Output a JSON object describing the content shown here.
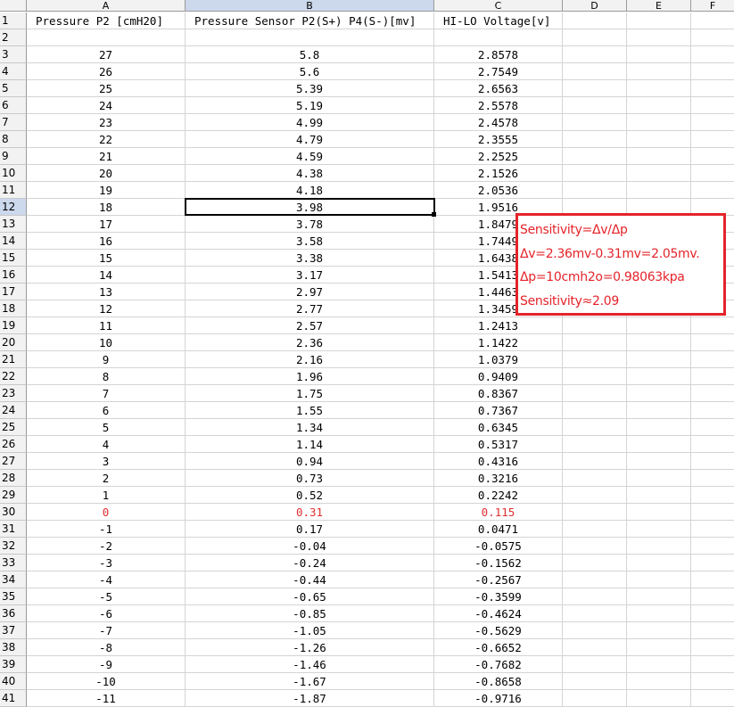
{
  "columns": [
    "A",
    "B",
    "C",
    "D",
    "E",
    "F"
  ],
  "selected_column": "B",
  "selected_row": "12",
  "rows": [
    {
      "n": "1",
      "a": "Pressure P2 [cmH20]",
      "b": "Pressure Sensor P2(S+) P4(S-)[mv]",
      "c": "HI-LO Voltage[v]"
    },
    {
      "n": "2",
      "a": "",
      "b": "",
      "c": ""
    },
    {
      "n": "3",
      "a": "27",
      "b": "5.8",
      "c": "2.8578"
    },
    {
      "n": "4",
      "a": "26",
      "b": "5.6",
      "c": "2.7549"
    },
    {
      "n": "5",
      "a": "25",
      "b": "5.39",
      "c": "2.6563"
    },
    {
      "n": "6",
      "a": "24",
      "b": "5.19",
      "c": "2.5578"
    },
    {
      "n": "7",
      "a": "23",
      "b": "4.99",
      "c": "2.4578"
    },
    {
      "n": "8",
      "a": "22",
      "b": "4.79",
      "c": "2.3555"
    },
    {
      "n": "9",
      "a": "21",
      "b": "4.59",
      "c": "2.2525"
    },
    {
      "n": "10",
      "a": "20",
      "b": "4.38",
      "c": "2.1526"
    },
    {
      "n": "11",
      "a": "19",
      "b": "4.18",
      "c": "2.0536"
    },
    {
      "n": "12",
      "a": "18",
      "b": "3.98",
      "c": "1.9516"
    },
    {
      "n": "13",
      "a": "17",
      "b": "3.78",
      "c": "1.8479"
    },
    {
      "n": "14",
      "a": "16",
      "b": "3.58",
      "c": "1.7449"
    },
    {
      "n": "15",
      "a": "15",
      "b": "3.38",
      "c": "1.6438"
    },
    {
      "n": "16",
      "a": "14",
      "b": "3.17",
      "c": "1.5413"
    },
    {
      "n": "17",
      "a": "13",
      "b": "2.97",
      "c": "1.4463"
    },
    {
      "n": "18",
      "a": "12",
      "b": "2.77",
      "c": "1.3459"
    },
    {
      "n": "19",
      "a": "11",
      "b": "2.57",
      "c": "1.2413"
    },
    {
      "n": "20",
      "a": "10",
      "b": "2.36",
      "c": "1.1422"
    },
    {
      "n": "21",
      "a": "9",
      "b": "2.16",
      "c": "1.0379"
    },
    {
      "n": "22",
      "a": "8",
      "b": "1.96",
      "c": "0.9409"
    },
    {
      "n": "23",
      "a": "7",
      "b": "1.75",
      "c": "0.8367"
    },
    {
      "n": "24",
      "a": "6",
      "b": "1.55",
      "c": "0.7367"
    },
    {
      "n": "25",
      "a": "5",
      "b": "1.34",
      "c": "0.6345"
    },
    {
      "n": "26",
      "a": "4",
      "b": "1.14",
      "c": "0.5317"
    },
    {
      "n": "27",
      "a": "3",
      "b": "0.94",
      "c": "0.4316"
    },
    {
      "n": "28",
      "a": "2",
      "b": "0.73",
      "c": "0.3216"
    },
    {
      "n": "29",
      "a": "1",
      "b": "0.52",
      "c": "0.2242"
    },
    {
      "n": "30",
      "a": "0",
      "b": "0.31",
      "c": "0.115",
      "red": true
    },
    {
      "n": "31",
      "a": "-1",
      "b": "0.17",
      "c": "0.0471"
    },
    {
      "n": "32",
      "a": "-2",
      "b": "-0.04",
      "c": "-0.0575"
    },
    {
      "n": "33",
      "a": "-3",
      "b": "-0.24",
      "c": "-0.1562"
    },
    {
      "n": "34",
      "a": "-4",
      "b": "-0.44",
      "c": "-0.2567"
    },
    {
      "n": "35",
      "a": "-5",
      "b": "-0.65",
      "c": "-0.3599"
    },
    {
      "n": "36",
      "a": "-6",
      "b": "-0.85",
      "c": "-0.4624"
    },
    {
      "n": "37",
      "a": "-7",
      "b": "-1.05",
      "c": "-0.5629"
    },
    {
      "n": "38",
      "a": "-8",
      "b": "-1.26",
      "c": "-0.6652"
    },
    {
      "n": "39",
      "a": "-9",
      "b": "-1.46",
      "c": "-0.7682"
    },
    {
      "n": "40",
      "a": "-10",
      "b": "-1.67",
      "c": "-0.8658"
    },
    {
      "n": "41",
      "a": "-11",
      "b": "-1.87",
      "c": "-0.9716"
    }
  ],
  "annotation": {
    "lines": [
      "Sensitivity=Δv/Δp",
      "Δv=2.36mv-0.31mv=2.05mv.",
      "Δp=10cmh2o=0.98063kpa",
      "Sensitivity≈2.09"
    ],
    "color": "#e4232a"
  },
  "colors": {
    "header_bg": "#f2f2f2",
    "selected_header_bg": "#ccd8ec",
    "highlight_text": "#e03030"
  }
}
